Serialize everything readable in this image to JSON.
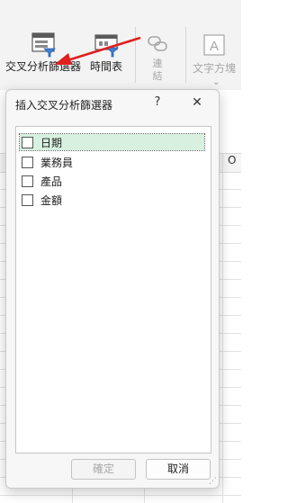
{
  "ribbon": {
    "slicer_label": "交叉分析篩選器",
    "timeline_label": "時間表",
    "link_label": "連結",
    "textbox_label": "文字方塊",
    "accent_color": "#e02020"
  },
  "sheet": {
    "visible_column": "O"
  },
  "dialog": {
    "title": "插入交叉分析篩選器",
    "help_label": "?",
    "close_label": "✕",
    "fields": [
      {
        "label": "日期",
        "checked": false,
        "selected": true
      },
      {
        "label": "業務員",
        "checked": false,
        "selected": false
      },
      {
        "label": "產品",
        "checked": false,
        "selected": false
      },
      {
        "label": "金額",
        "checked": false,
        "selected": false
      }
    ],
    "ok_label": "確定",
    "cancel_label": "取消"
  }
}
